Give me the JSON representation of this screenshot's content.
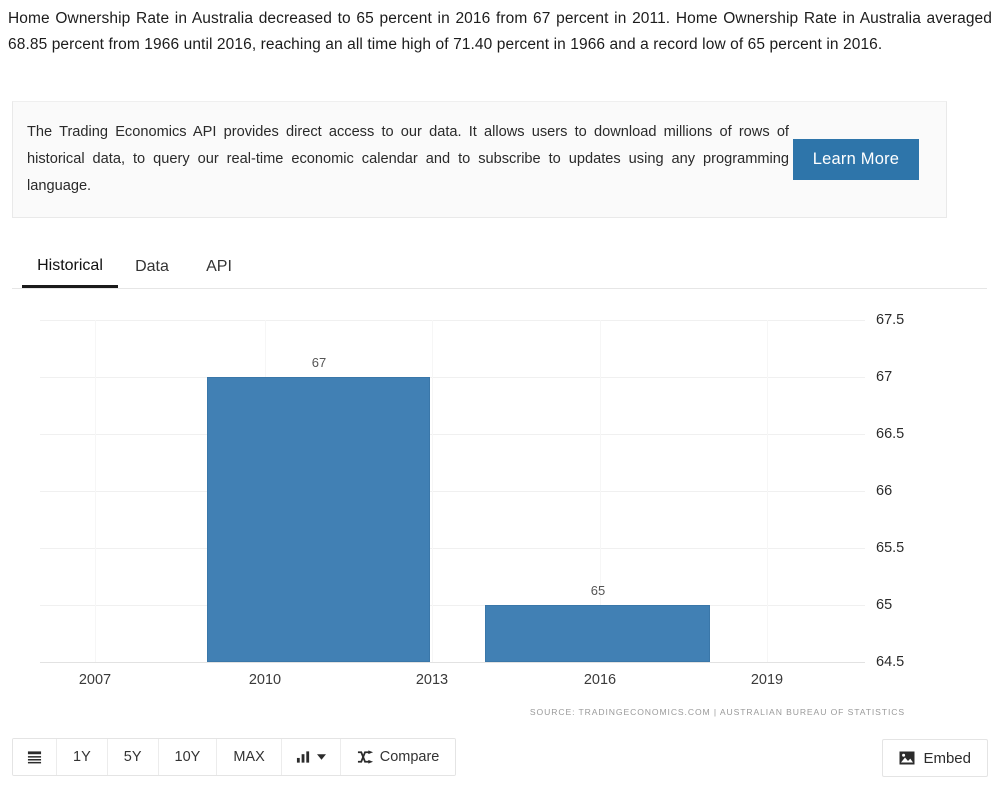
{
  "intro": {
    "paragraph": "Home Ownership Rate in Australia decreased to 65 percent in 2016 from 67 percent in 2011. Home Ownership Rate in Australia averaged 68.85 percent from 1966 until 2016, reaching an all time high of 71.40 percent in 1966 and a record low of 65 percent in 2016."
  },
  "api_promo": {
    "text": "The Trading Economics API provides direct access to our data. It allows users to download millions of rows of historical data, to query our real-time economic calendar and to subscribe to updates using any programming language.",
    "button_label": "Learn More",
    "button_color": "#2e75aa"
  },
  "tabs": {
    "items": [
      {
        "label": "Historical",
        "active": true
      },
      {
        "label": "Data",
        "active": false
      },
      {
        "label": "API",
        "active": false
      }
    ]
  },
  "chart_data": {
    "type": "bar",
    "title": "",
    "subtitle": "",
    "xlabel": "",
    "ylabel": "",
    "categories": [
      "2011",
      "2016"
    ],
    "values": [
      67,
      65
    ],
    "data_labels": [
      "67",
      "65"
    ],
    "series": [
      {
        "name": "Home Ownership Rate",
        "values": [
          67,
          65
        ]
      }
    ],
    "ylim": [
      64.5,
      67.5
    ],
    "ytick_labels": [
      "67.5",
      "67",
      "66.5",
      "66",
      "65.5",
      "65",
      "64.5"
    ],
    "ytick_values": [
      67.5,
      67,
      66.5,
      66,
      65.5,
      65,
      64.5
    ],
    "xtick_labels": [
      "2007",
      "2010",
      "2013",
      "2016",
      "2019"
    ],
    "xtick_values": [
      2007,
      2010,
      2013,
      2016,
      2019
    ],
    "grid": true,
    "legend": "none",
    "bar_color": "#4180b4",
    "source": "SOURCE: TRADINGECONOMICS.COM  |  AUSTRALIAN BUREAU OF STATISTICS"
  },
  "toolbar": {
    "range_buttons": [
      "1Y",
      "5Y",
      "10Y",
      "MAX"
    ],
    "compare_label": "Compare",
    "embed_label": "Embed"
  }
}
